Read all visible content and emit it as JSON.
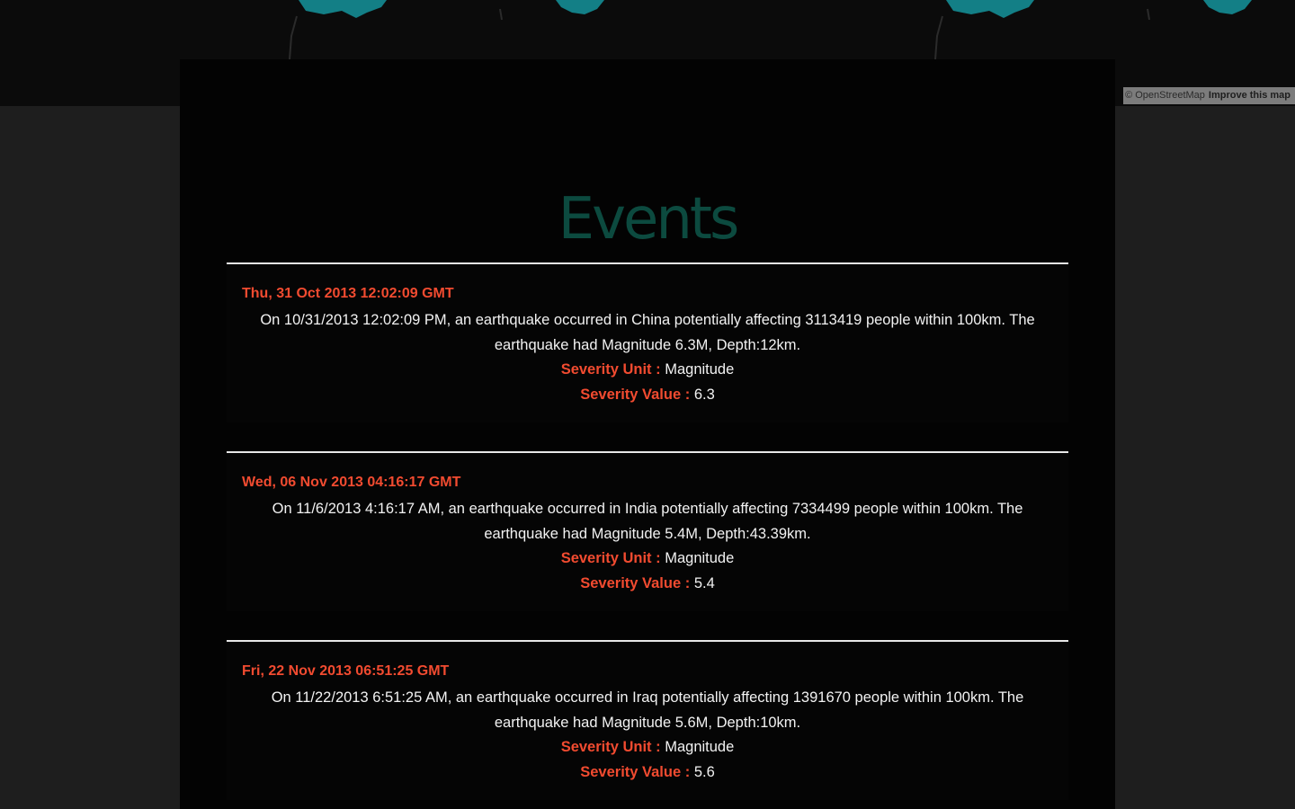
{
  "map": {
    "attribution_osm": "© OpenStreetMap",
    "attribution_improve": "Improve this map",
    "land_color": "#137f86"
  },
  "page": {
    "title": "Events"
  },
  "severity_unit_label": "Severity Unit :",
  "severity_value_label": "Severity Value :",
  "events": [
    {
      "date": "Thu, 31 Oct 2013 12:02:09 GMT",
      "description": "On 10/31/2013 12:02:09 PM, an earthquake occurred in China potentially affecting 3113419 people within 100km. The earthquake had Magnitude 6.3M, Depth:12km.",
      "severity_unit": "Magnitude",
      "severity_value": "6.3"
    },
    {
      "date": "Wed, 06 Nov 2013 04:16:17 GMT",
      "description": "On 11/6/2013 4:16:17 AM, an earthquake occurred in India potentially affecting 7334499 people within 100km. The earthquake had Magnitude 5.4M, Depth:43.39km.",
      "severity_unit": "Magnitude",
      "severity_value": "5.4"
    },
    {
      "date": "Fri, 22 Nov 2013 06:51:25 GMT",
      "description": "On 11/22/2013 6:51:25 AM, an earthquake occurred in Iraq potentially affecting 1391670 people within 100km. The earthquake had Magnitude 5.6M, Depth:10km.",
      "severity_unit": "Magnitude",
      "severity_value": "5.6"
    }
  ]
}
